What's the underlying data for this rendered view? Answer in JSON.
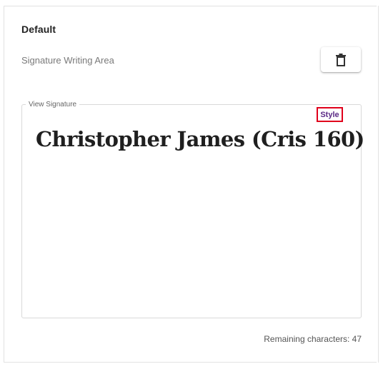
{
  "section": {
    "title": "Default",
    "area_label": "Signature Writing Area"
  },
  "delete_button": {
    "icon": "trash-icon"
  },
  "view": {
    "legend": "View Signature",
    "style_link": "Style",
    "signature_text": "Christopher James (Cris 160)"
  },
  "footer": {
    "remaining_label": "Remaining characters: 47"
  },
  "colors": {
    "style_link_text": "#5b2a86",
    "highlight_border": "#e0001b"
  }
}
